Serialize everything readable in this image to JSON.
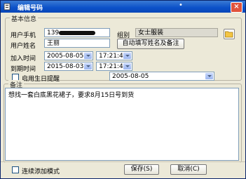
{
  "window": {
    "title": "编辑号码",
    "title_marker": "•",
    "close_label": "×"
  },
  "section_basic": "基本信息",
  "phone": {
    "label": "用户手机",
    "value_prefix": "139"
  },
  "group": {
    "label": "组别",
    "value": "女士服装"
  },
  "name": {
    "label": "用户姓名",
    "value": "王丽"
  },
  "autofill_button": "自动填写姓名及备注",
  "join_time": {
    "label": "加入时间",
    "date": "2005-08-05",
    "time": "17:21:43"
  },
  "expire_time": {
    "label": "到期时间",
    "date": "2015-08-03",
    "time": "17:21:43"
  },
  "birthday": {
    "label": "启用生日提醒",
    "date": "2005-08-05",
    "checked": false
  },
  "remark": {
    "label": "备注",
    "text": "想找一套白底黑花裙子，要求8月15日号到货"
  },
  "continuous_mode": {
    "label": "连续添加模式",
    "checked": false
  },
  "save_button": "保存(S)",
  "cancel_button": "取消(C)"
}
